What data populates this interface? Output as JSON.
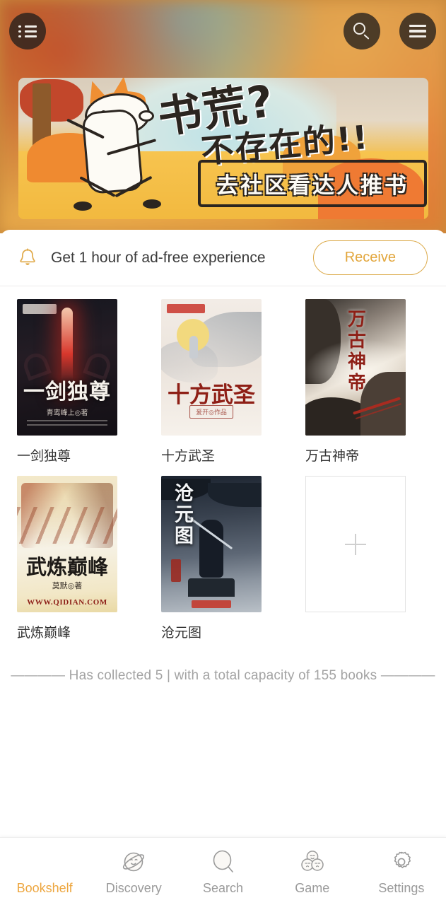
{
  "header": {
    "list_icon": "list-icon",
    "search_icon": "search-icon",
    "menu_icon": "hamburger-menu-icon"
  },
  "banner": {
    "hero_line1": "书荒?",
    "hero_line2": "不存在的!!",
    "subtitle": "去社区看达人推书",
    "character": "fox-mascot"
  },
  "notice": {
    "icon": "bell-icon",
    "text": "Get 1 hour of ad-free experience",
    "button_label": "Receive",
    "accent_color": "#dcab4c"
  },
  "bookshelf": {
    "books": [
      {
        "title": "一剑独尊",
        "cover_title": "一剑独尊",
        "cover_author": "青鸾峰上◎著",
        "cover_style": "c1"
      },
      {
        "title": "十方武圣",
        "cover_title": "十方武圣",
        "cover_author": "爰开◎作品",
        "cover_style": "c2"
      },
      {
        "title": "万古神帝",
        "cover_title": "万古神帝",
        "cover_author": "",
        "cover_style": "c3"
      },
      {
        "title": "武炼巅峰",
        "cover_title": "武炼巅峰",
        "cover_author": "莫默◎著",
        "cover_domain": "WWW.QIDIAN.COM",
        "cover_style": "c4"
      },
      {
        "title": "沧元图",
        "cover_title": "沧元图",
        "cover_author": "",
        "cover_style": "c5"
      }
    ],
    "add_tile": {
      "icon": "plus-icon",
      "label": ""
    },
    "collected_text": "———— Has collected 5 | with a total capacity of 155 books ————",
    "collected_count": 5,
    "total_capacity": 155
  },
  "tabbar": {
    "active_color": "#eda63f",
    "inactive_color": "#9a9a9a",
    "tabs": [
      {
        "label": "Bookshelf",
        "icon": "bookshelf-icon",
        "active": true
      },
      {
        "label": "Discovery",
        "icon": "planet-face-icon",
        "active": false
      },
      {
        "label": "Search",
        "icon": "magnifier-face-icon",
        "active": false
      },
      {
        "label": "Game",
        "icon": "three-faces-icon",
        "active": false
      },
      {
        "label": "Settings",
        "icon": "gear-icon",
        "active": false
      }
    ]
  }
}
